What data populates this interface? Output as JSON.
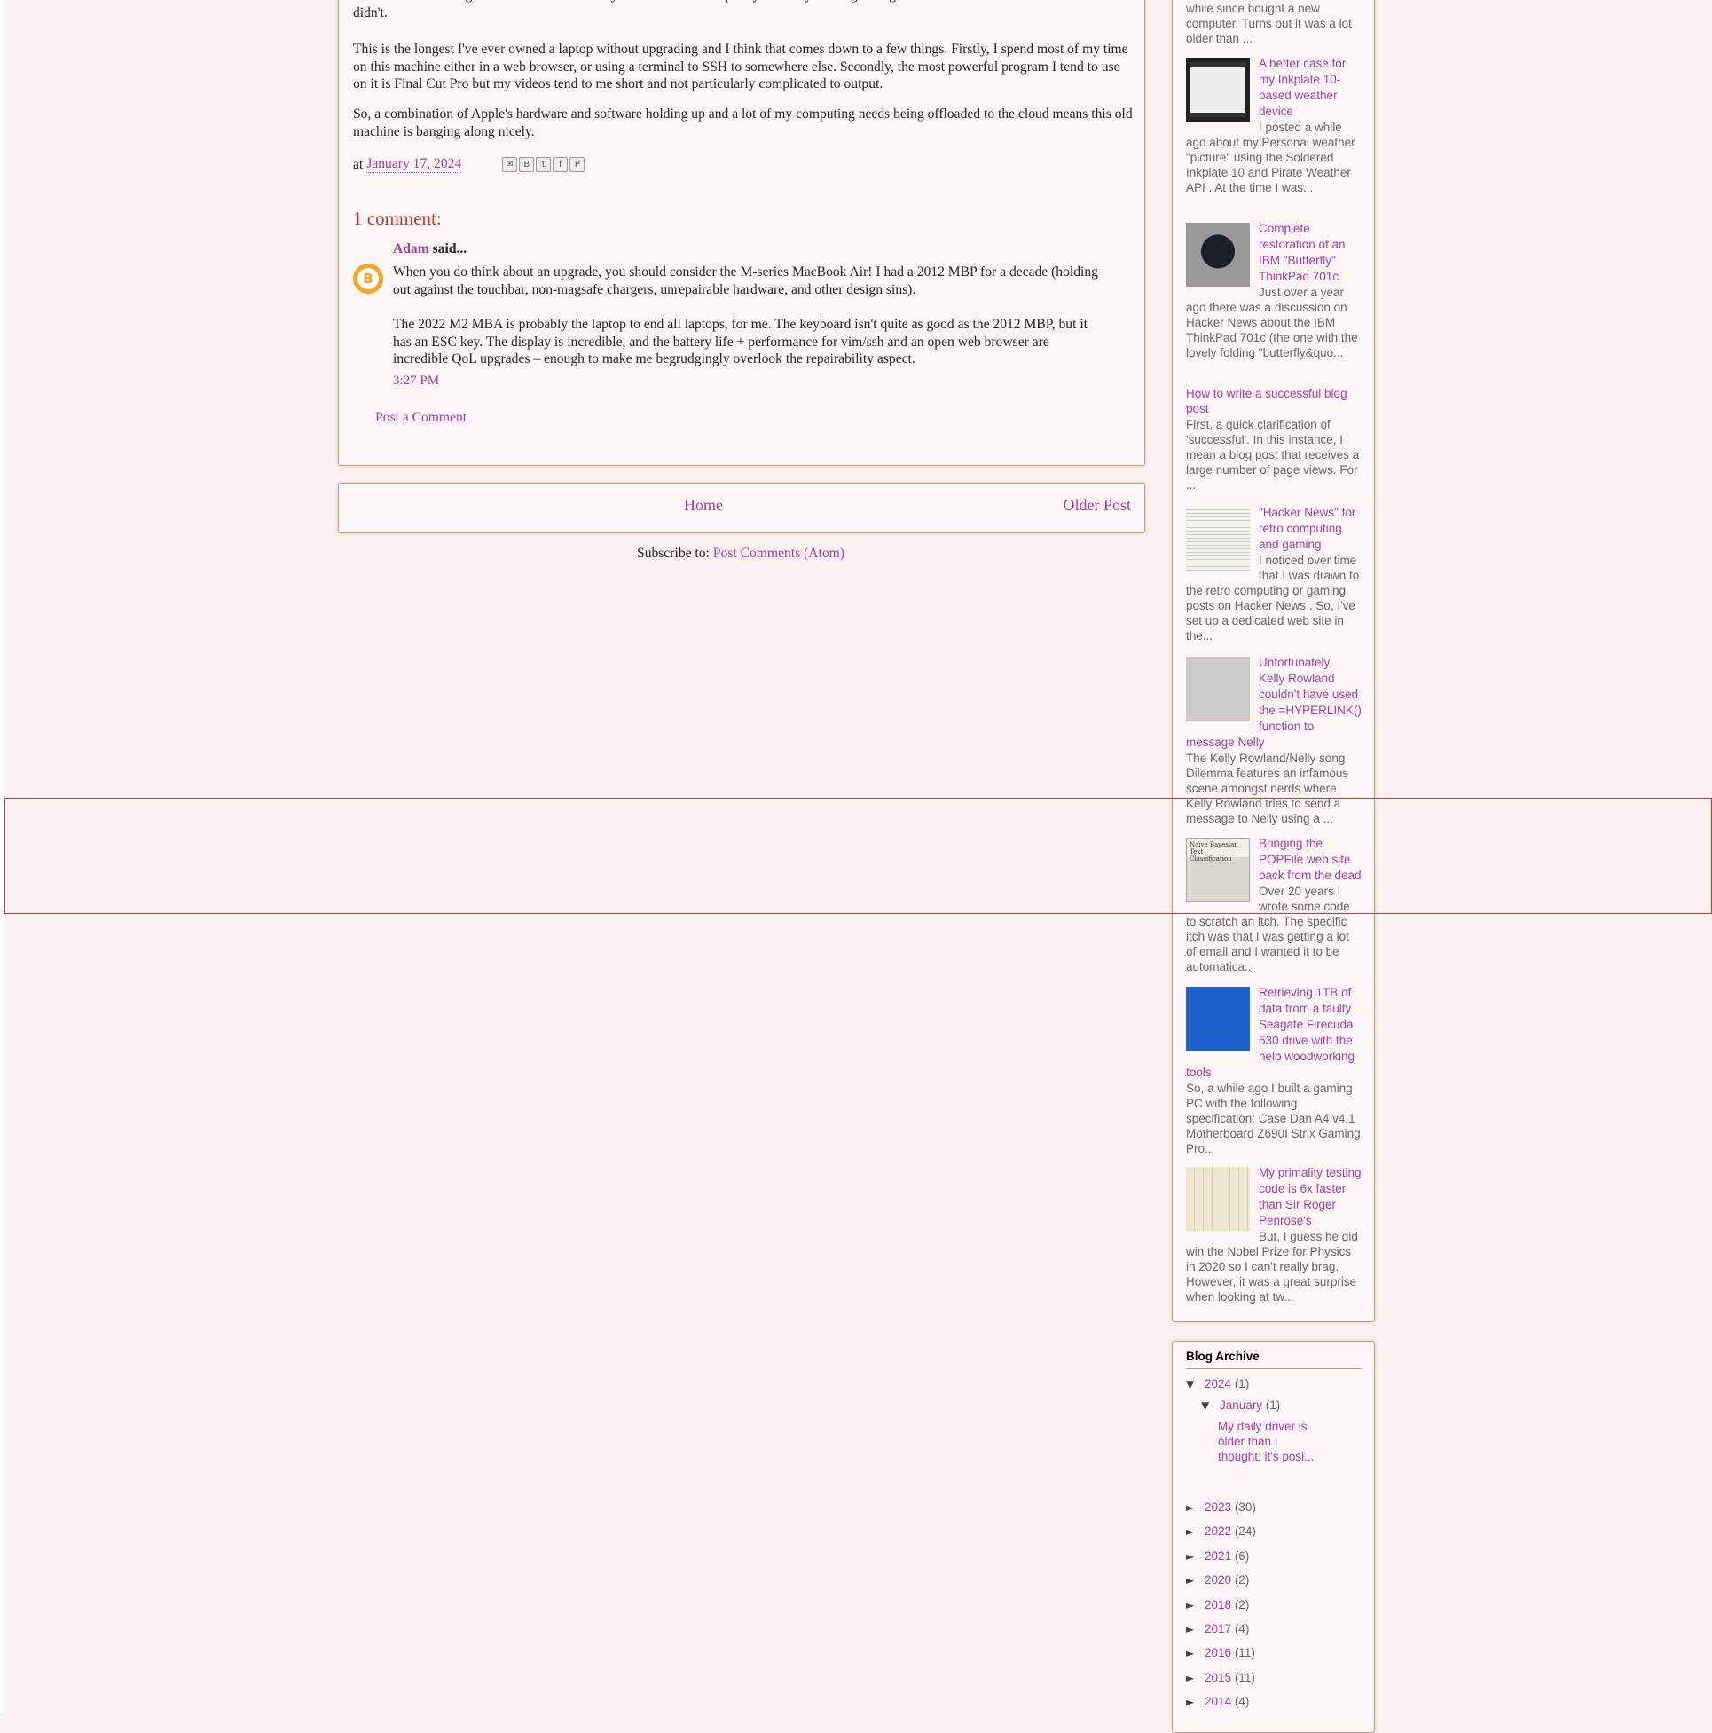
{
  "post": {
    "para0": "But there is one thing I hate about it: the bloody Touch Bar and it's phony ESC key. I thought I'd get used to the Touch Bar but it turns out I didn't.",
    "para1": "This is the longest I've ever owned a laptop without upgrading and I think that comes down to a few things. Firstly, I spend most of my time on this machine either in a web browser, or using a terminal to SSH to somewhere else. Secondly, the most powerful program I tend to use on it is Final Cut Pro but my videos tend to me short and not particularly complicated to output.",
    "para2": "So, a combination of Apple's hardware and software holding up and a lot of my computing needs being offloaded to the cloud means this old machine is banging along nicely.",
    "footer_at": "at",
    "date": "January 17, 2024",
    "share_icons": [
      "email-icon",
      "blogthis-icon",
      "twitter-icon",
      "facebook-icon",
      "pinterest-icon"
    ],
    "share_glyphs": [
      "✉",
      "B",
      "t",
      "f",
      "P"
    ]
  },
  "comments": {
    "heading": "1 comment:",
    "author": "Adam",
    "said": " said...",
    "body1": "When you do think about an upgrade, you should consider the M-series MacBook Air! I had a 2012 MBP for a decade (holding out against the touchbar, non-magsafe chargers, unrepairable hardware, and other design sins).",
    "body2": "The 2022 M2 MBA is probably the laptop to end all laptops, for me. The keyboard isn't quite as good as the 2012 MBP, but it has an ESC key. The display is incredible, and the battery life + performance for vim/ssh and an open web browser are incredible QoL upgrades – enough to make me begrudgingly overlook the repairability aspect.",
    "time": "3:27 PM",
    "post_link": "Post a Comment"
  },
  "pager": {
    "home": "Home",
    "older": "Older Post"
  },
  "subscribe": {
    "label": "Subscribe to: ",
    "link": "Post Comments (Atom)"
  },
  "popular": {
    "top_snippet": "while since bought a new computer. Turns out it was a lot older than ...",
    "items": [
      {
        "title": "A better case for my Inkplate 10-based weather device",
        "snippet": "I posted a while ago about my Personal weather \"picture\" using the Soldered Inkplate 10 and Pirate Weather API . At the time I was...",
        "thumb": "weather-thumbnail"
      },
      {
        "title": "Complete restoration of an IBM \"Butterfly\" ThinkPad 701c",
        "snippet": "Just over a year ago there was a discussion on Hacker News about the IBM ThinkPad 701c (the one with the lovely folding \"butterfly&quo...",
        "thumb": "thinkpad-thumbnail"
      },
      {
        "title": "How to write a successful blog post",
        "snippet": "First, a quick clarification of 'successful'. In this instance, I mean a blog post that receives a large number of page views. For ...",
        "thumb": ""
      },
      {
        "title": "\"Hacker News\" for retro computing and gaming",
        "snippet": "I noticed over time that I was drawn to the retro computing or gaming posts on Hacker News . So, I've set up a dedicated web site in the...",
        "thumb": "hn-thumbnail"
      },
      {
        "title": "Unfortunately, Kelly Rowland couldn't have used the =HYPERLINK() function to message Nelly",
        "snippet": "The Kelly Rowland/Nelly song Dilemma features an infamous scene amongst nerds where Kelly Rowland tries to send a message to Nelly using a ...",
        "thumb": "kelly-thumbnail"
      },
      {
        "title": "Bringing the POPFile web site back from the dead",
        "snippet": "Over 20 years I wrote some code to scratch an itch. The specific itch was that I was getting a lot of email and I wanted it to be automatica...",
        "thumb": "popfile-thumbnail",
        "thumb_text": "Naïve Bayesian Text Classification"
      },
      {
        "title": "Retrieving 1TB of data from a faulty Seagate Firecuda 530 drive with the help woodworking tools",
        "snippet": "So, a while ago I built a gaming PC with the following specification:   Case          Dan A4 v4.1   Motherboard    Z690I Strix Gaming   Pro...",
        "thumb": "bsod-thumbnail"
      },
      {
        "title": "My primality testing code is 6x faster than Sir Roger Penrose's",
        "snippet": "But, I guess he did win the Nobel Prize for Physics in 2020 so I can't really brag. However, it was a great surprise when looking at tw...",
        "thumb": "primality-thumbnail"
      }
    ]
  },
  "archive": {
    "heading": "Blog Archive",
    "expanded_year": {
      "toggle": "▼",
      "year": "2024",
      "count": "(1)"
    },
    "expanded_month": {
      "toggle": "▼",
      "month": "January",
      "count": "(1)"
    },
    "post": "My daily driver is older than I thought; it's posi...",
    "years": [
      {
        "toggle": "►",
        "year": "2023",
        "count": "(30)"
      },
      {
        "toggle": "►",
        "year": "2022",
        "count": "(24)"
      },
      {
        "toggle": "►",
        "year": "2021",
        "count": "(6)"
      },
      {
        "toggle": "►",
        "year": "2020",
        "count": "(2)"
      },
      {
        "toggle": "►",
        "year": "2018",
        "count": "(2)"
      },
      {
        "toggle": "►",
        "year": "2017",
        "count": "(4)"
      },
      {
        "toggle": "►",
        "year": "2016",
        "count": "(11)"
      },
      {
        "toggle": "►",
        "year": "2015",
        "count": "(11)"
      },
      {
        "toggle": "►",
        "year": "2014",
        "count": "(4)"
      }
    ]
  },
  "colors": {
    "link": "#b23a9a",
    "heading": "#c0392b",
    "background": "#fbf3f1",
    "border": "#c69a7f",
    "highlight": "#e03030"
  }
}
